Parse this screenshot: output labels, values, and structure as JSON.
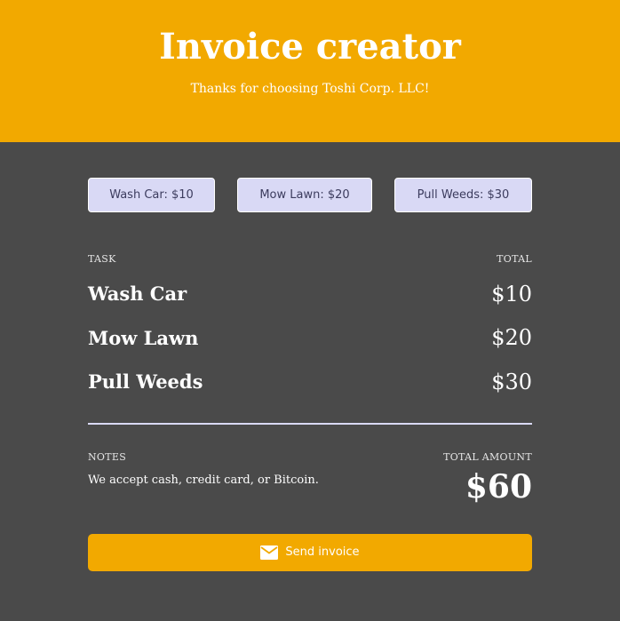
{
  "header": {
    "title": "Invoice creator",
    "subtitle": "Thanks for choosing Toshi Corp. LLC!"
  },
  "task_buttons": [
    {
      "label": "Wash Car: $10"
    },
    {
      "label": "Mow Lawn: $20"
    },
    {
      "label": "Pull Weeds: $30"
    }
  ],
  "table": {
    "task_header": "TASK",
    "total_header": "TOTAL",
    "rows": [
      {
        "task": "Wash Car",
        "total": "$10"
      },
      {
        "task": "Mow Lawn",
        "total": "$20"
      },
      {
        "task": "Pull Weeds",
        "total": "$30"
      }
    ]
  },
  "summary": {
    "notes_label": "NOTES",
    "notes_text": "We accept cash, credit card, or Bitcoin.",
    "total_label": "TOTAL AMOUNT",
    "total_value": "$60"
  },
  "send_button": {
    "label": "Send invoice",
    "icon": "mail-icon"
  },
  "colors": {
    "accent": "#f2a900",
    "background": "#4a4a4a",
    "button_bg": "#d9d9f5",
    "button_text": "#3c3c5e"
  }
}
